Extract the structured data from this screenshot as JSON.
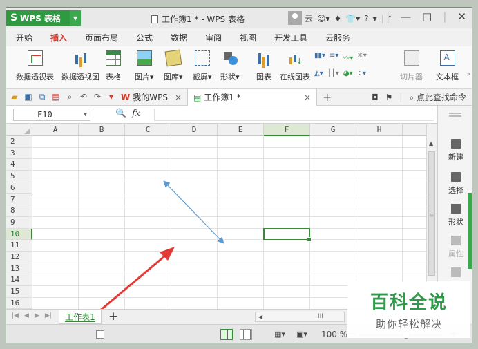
{
  "window": {
    "app_button": "WPS 表格",
    "app_logo": "S",
    "title": "工作簿1 * - WPS 表格",
    "cloud": "云",
    "help": "?",
    "controls": [
      "—",
      "□",
      "✕"
    ]
  },
  "ribbon_tabs": [
    {
      "label": "开始",
      "active": false
    },
    {
      "label": "插入",
      "active": true
    },
    {
      "label": "页面布局",
      "active": false
    },
    {
      "label": "公式",
      "active": false
    },
    {
      "label": "数据",
      "active": false
    },
    {
      "label": "审阅",
      "active": false
    },
    {
      "label": "视图",
      "active": false
    },
    {
      "label": "开发工具",
      "active": false
    },
    {
      "label": "云服务",
      "active": false
    }
  ],
  "ribbon": {
    "pivot_table": "数据透视表",
    "pivot_chart": "数据透视图",
    "table": "表格",
    "picture": "图片",
    "gallery": "图库",
    "screenshot": "截屏",
    "shapes": "形状",
    "chart": "图表",
    "online_chart": "在线图表",
    "frame": "切片器",
    "textbox": "文本框"
  },
  "quickbar": {
    "my_wps": "我的WPS",
    "doc_tab": "工作簿1 *",
    "search": "点此查找命令"
  },
  "formula_bar": {
    "name_box": "F10",
    "fx": "fx",
    "value": ""
  },
  "columns": [
    "A",
    "B",
    "C",
    "D",
    "E",
    "F",
    "G",
    "H"
  ],
  "selected_column": "F",
  "rows": [
    "2",
    "3",
    "4",
    "5",
    "6",
    "7",
    "8",
    "9",
    "10",
    "11",
    "12",
    "13",
    "14",
    "15",
    "16"
  ],
  "selected_row": "10",
  "active_cell": "F10",
  "side_panel": {
    "new": "新建",
    "select": "选择",
    "shape": "形状",
    "property": "属性"
  },
  "sheets": [
    {
      "label": "工作表1",
      "active": true
    }
  ],
  "status": {
    "zoom": "100 %"
  },
  "watermark": {
    "big": "百科全说",
    "small": "助你轻松解决"
  },
  "colors": {
    "accent_green": "#3b8a3b",
    "app_green": "#2f9a41",
    "active_tab_red": "#d2392b",
    "annotation_red": "#e53935",
    "line_blue": "#5b9bd5"
  }
}
